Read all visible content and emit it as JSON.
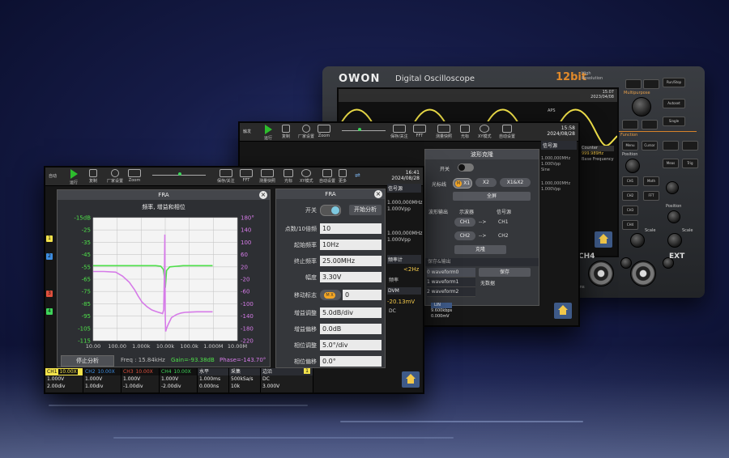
{
  "device": {
    "brand": "OWON",
    "title": "Digital Oscilloscope",
    "bit_badge": "12bit",
    "bit_sub": "High Resolution",
    "time_top": "15:07",
    "date_top": "2023/04/08",
    "ch4_label": "CH4",
    "ext_label": "EXT",
    "vrms_label": "5 Vrms",
    "buttons": [
      "Run/Stop",
      "Autoset",
      "Single",
      "Menu",
      "Cursor",
      "Meas",
      "Trig",
      "CH1",
      "CH2",
      "CH3",
      "CH4",
      "Math",
      "FFT"
    ],
    "knob_labels": [
      "Multipurpose",
      "Function",
      "Position",
      "Scale",
      "Position",
      "Scale",
      "Level"
    ],
    "counter_label": "Counter",
    "counter_value": "999.989Hz",
    "counter_sub": "Base Frequency",
    "aps_label": "APS"
  },
  "middle_screen": {
    "toolbar": [
      "触发",
      "运行",
      "复制",
      "厂家设置",
      "Zoom",
      "保存/关注",
      "FFT",
      "测量快照",
      "光标",
      "XY模式",
      "自动设置"
    ],
    "time": "15:58",
    "date": "2024/08/28",
    "side_header": "信号源",
    "side_items": [
      "1.000,000MHz",
      "1.000Vpp",
      "Sine"
    ],
    "side_items_2": [
      "1.000,000MHz",
      "1.000Vpp"
    ],
    "lin_label": "LIN",
    "lin_vals": [
      "9.600kbps",
      "0.000mV"
    ],
    "dialog": {
      "title": "波形克隆",
      "switch_label": "开关",
      "cursor_label": "光标线",
      "x1": "X1",
      "x2": "X2",
      "x1x2": "X1&X2",
      "fullscreen": "全屏",
      "wave_out": "波形输出",
      "scope_col": "示波器",
      "gen_col": "信号源",
      "ch1_from": "CH1",
      "ch1_to": "CH1",
      "ch2_from": "CH2",
      "ch2_to": "CH2",
      "clone": "克隆",
      "save_output": "保存&输出",
      "waveforms": [
        "0  waveform0",
        "1  waveform1",
        "2  waveform2"
      ],
      "save": "保存",
      "no_data": "无数据"
    }
  },
  "front_screen": {
    "toolbar": [
      "自动",
      "运行",
      "复制",
      "厂家设置",
      "Zoom",
      "保存/关注",
      "FFT",
      "测量快照",
      "光标",
      "XY模式",
      "自动设置",
      "更多"
    ],
    "time": "16:41",
    "date": "2024/08/28",
    "fra_window_title": "FRA",
    "chart_heading": "频率, 增益和相位",
    "stop_button": "停止分析",
    "readout_freq": "Freq : 15.84kHz",
    "readout_gain": "Gain=-93.38dB",
    "readout_phase": "Phase=-143.70°",
    "settings": {
      "title": "FRA",
      "switch_label": "开关",
      "start_button": "开始分析",
      "rows": [
        {
          "label": "点数/10倍频",
          "value": "10"
        },
        {
          "label": "起始频率",
          "value": "10Hz"
        },
        {
          "label": "终止频率",
          "value": "25.00MHz"
        },
        {
          "label": "幅度",
          "value": "3.30V"
        },
        {
          "label": "移动标志",
          "value": "0"
        },
        {
          "label": "增益调整",
          "value": "5.0dB/div"
        },
        {
          "label": "增益偏移",
          "value": "0.0dB"
        },
        {
          "label": "相位调整",
          "value": "5.0°/div"
        },
        {
          "label": "相位偏移",
          "value": "0.0°"
        }
      ],
      "mx_badge": "M X"
    },
    "right_strip": {
      "header": "信号源",
      "freq": "1.000,000MHz",
      "vpp": "1.000Vpp",
      "freq2": "1.000,000MHz",
      "vpp2": "1.000Vpp",
      "freq_counter": "频率计",
      "counter_val": "<2Hz",
      "counter_unit": "频率",
      "dvm": "DVM",
      "dvm_val": "-20.13mV",
      "dvm_mode": "DC"
    },
    "channels": [
      {
        "name": "CH1",
        "probe": "10.00X",
        "scale": "1.000V",
        "offset": "2.00div",
        "color": "#f2e24a"
      },
      {
        "name": "CH2",
        "probe": "10.00X",
        "scale": "1.000V",
        "offset": "1.00div",
        "color": "#3d8de0"
      },
      {
        "name": "CH3",
        "probe": "10.00X",
        "scale": "1.000V",
        "offset": "-1.00div",
        "color": "#e0503d"
      },
      {
        "name": "CH4",
        "probe": "10.00X",
        "scale": "1.000V",
        "offset": "-2.00div",
        "color": "#3dd45a"
      }
    ],
    "horizontal": {
      "title": "水平",
      "time": "1.000ms",
      "offset": "0.000ns"
    },
    "acquire": {
      "title": "采集",
      "rate": "500kSa/s",
      "depth": "10k"
    },
    "trigger": {
      "title": "边沿",
      "mode": "DC",
      "level": "3.000V"
    }
  },
  "chart_data": {
    "type": "line",
    "title": "频率, 增益和相位",
    "xlabel": "",
    "ylabel": "",
    "x_ticks": [
      "10.00",
      "100.00",
      "1.000k",
      "10.00k",
      "100.0k",
      "1.000M",
      "10.00M"
    ],
    "y_left_ticks": [
      "-15dB",
      "-25",
      "-35",
      "-45",
      "-55",
      "-65",
      "-75",
      "-85",
      "-95",
      "-105",
      "-115"
    ],
    "y_right_ticks": [
      "180°",
      "140",
      "100",
      "60",
      "20",
      "-20",
      "-60",
      "-100",
      "-140",
      "-180",
      "-220"
    ],
    "ylim_left": [
      -115,
      -15
    ],
    "ylim_right": [
      -220,
      180
    ],
    "xlim": [
      10,
      25000000
    ],
    "xscale": "log",
    "grid": true,
    "series": [
      {
        "axis": "left",
        "color": "#4ee04a",
        "x": [
          10,
          30,
          100,
          300,
          1000,
          3000,
          6000,
          10000,
          13000,
          15000,
          16000,
          18000,
          25000,
          50000,
          100000,
          300000,
          1000000,
          2000000
        ],
        "y": [
          -54,
          -54,
          -54,
          -54,
          -54,
          -54,
          -54,
          -54.5,
          -57,
          -65,
          -72,
          -58,
          -55,
          -54.5,
          -54,
          -54,
          -54,
          -54
        ]
      },
      {
        "axis": "right",
        "color": "#d67be8",
        "x": [
          10,
          30,
          100,
          200,
          400,
          700,
          1000,
          1500,
          2500,
          4000,
          6000,
          8000,
          10000,
          12000,
          13500,
          14500,
          15200,
          15840,
          16500,
          18000,
          22000,
          30000,
          50000,
          80000,
          120000,
          200000,
          400000,
          1000000,
          2000000
        ],
        "y": [
          5,
          5,
          3,
          -10,
          -30,
          -55,
          -75,
          -95,
          -110,
          -120,
          -125,
          -128,
          -130,
          -132,
          -120,
          0,
          125,
          -140,
          -190,
          -180,
          -165,
          -145,
          -135,
          -130,
          -128,
          -127,
          -126,
          -126,
          -126
        ]
      }
    ]
  }
}
